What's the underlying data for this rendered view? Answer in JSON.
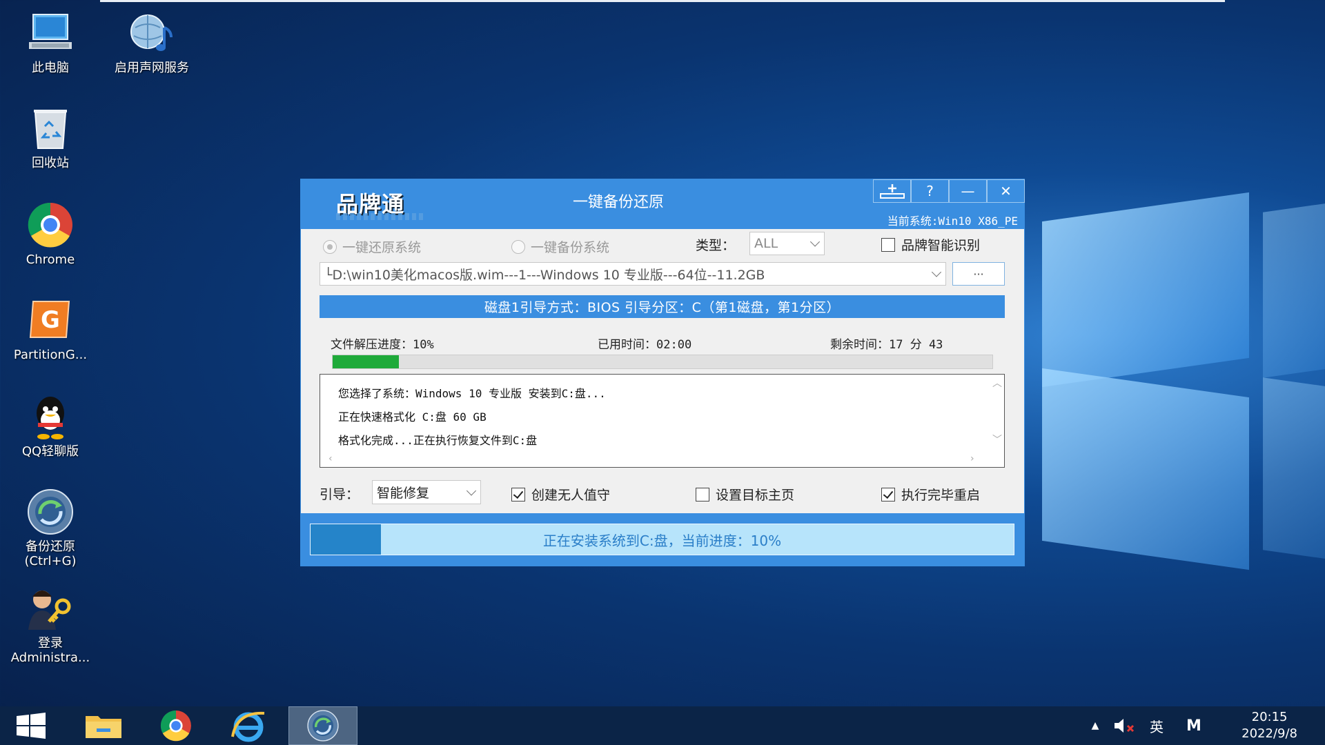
{
  "desktop": {
    "icons": [
      {
        "label": "此电脑",
        "icon": "computer-icon"
      },
      {
        "label": "启用声网服务",
        "icon": "globe-music-icon"
      },
      {
        "label": "回收站",
        "icon": "recycle-bin-icon"
      },
      {
        "label": "Chrome",
        "icon": "chrome-icon"
      },
      {
        "label": "PartitionG...",
        "icon": "partitionguru-icon"
      },
      {
        "label": "QQ轻聊版",
        "icon": "qq-icon"
      },
      {
        "label": "备份还原\n(Ctrl+G)",
        "icon": "backup-restore-icon"
      },
      {
        "label": "登录\nAdministra...",
        "icon": "login-admin-icon"
      }
    ]
  },
  "window": {
    "logo_text": "品牌通",
    "title": "一键备份还原",
    "current_system": "当前系统:Win10 X86_PE",
    "buttons": {
      "pin": "pin-icon",
      "help": "?",
      "minimize": "—",
      "close": "✕"
    },
    "mode": {
      "restore_label": "一键还原系统",
      "backup_label": "一键备份系统",
      "selected": "restore"
    },
    "type": {
      "label": "类型：",
      "value": "ALL"
    },
    "brand_detect": {
      "label": "品牌智能识别",
      "checked": false
    },
    "image_path": "└D:\\win10美化macos版.wim---1---Windows 10 专业版---64位--11.2GB",
    "browse_label": "···",
    "disk_info": "磁盘1引导方式：BIOS  引导分区：C（第1磁盘，第1分区）",
    "progress": {
      "label": "文件解压进度：",
      "value_text": "10%",
      "percent": 10,
      "elapsed_label": "已用时间：",
      "elapsed_value": "02:00",
      "remaining_label": "剩余时间：",
      "remaining_value": "17 分 43"
    },
    "log": [
      "您选择了系统：Windows 10 专业版  安装到C:盘...",
      "正在快速格式化 C:盘 60 GB",
      "格式化完成...正在执行恢复文件到C:盘"
    ],
    "boot": {
      "label": "引导：",
      "value": "智能修复"
    },
    "options": {
      "unattended": {
        "label": "创建无人值守",
        "checked": true
      },
      "homepage": {
        "label": "设置目标主页",
        "checked": false
      },
      "reboot": {
        "label": "执行完毕重启",
        "checked": true
      }
    },
    "footer": {
      "text": "正在安装系统到C:盘，当前进度：10%",
      "percent": 10
    }
  },
  "taskbar": {
    "items": [
      "start-icon",
      "file-explorer-icon",
      "chrome-icon",
      "ie-icon",
      "backup-restore-icon"
    ],
    "active_index": 4,
    "tray": {
      "overflow": "▲",
      "volume": "volume-muted-icon",
      "ime": "英",
      "ime_mode": "M"
    },
    "time": "20:15",
    "date": "2022/9/8"
  },
  "colors": {
    "accent": "#3a8ee0",
    "progress_green": "#1faa3a",
    "footer_fill": "#2584c9"
  }
}
